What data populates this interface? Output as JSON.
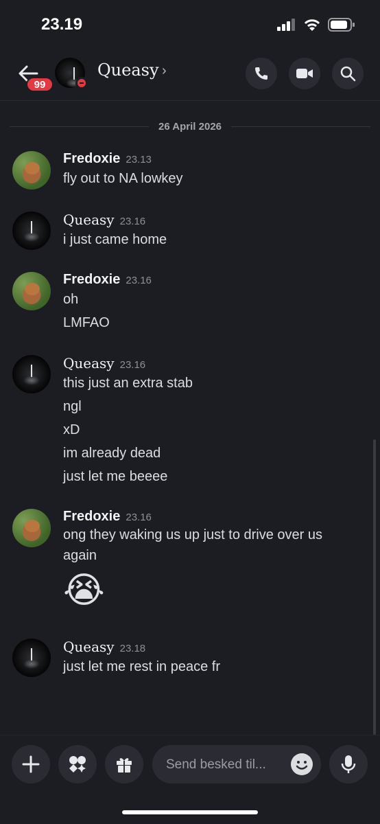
{
  "status": {
    "time": "23.19"
  },
  "header": {
    "badge": "99",
    "name": "Queasy"
  },
  "date_separator": "26 April 2026",
  "messages": [
    {
      "author": "Fredoxie",
      "time": "23.13",
      "lines": [
        "fly out to NA lowkey"
      ]
    },
    {
      "author": "Queasy",
      "time": "23.16",
      "lines": [
        "i just came home"
      ]
    },
    {
      "author": "Fredoxie",
      "time": "23.16",
      "lines": [
        "oh",
        "LMFAO"
      ]
    },
    {
      "author": "Queasy",
      "time": "23.16",
      "lines": [
        "this just an extra stab",
        "ngl",
        "xD",
        "im already dead",
        "just let me beeee"
      ]
    },
    {
      "author": "Fredoxie",
      "time": "23.16",
      "lines": [
        "ong they waking us up just to drive over us",
        "again"
      ],
      "emoji": "😭"
    },
    {
      "author": "Queasy",
      "time": "23.18",
      "lines": [
        "just let me rest in peace fr"
      ]
    }
  ],
  "composer": {
    "placeholder": "Send besked til..."
  },
  "icons": [
    "back-arrow-icon",
    "call-icon",
    "video-icon",
    "search-icon",
    "plus-icon",
    "apps-icon",
    "gift-icon",
    "emoji-icon",
    "microphone-icon"
  ]
}
